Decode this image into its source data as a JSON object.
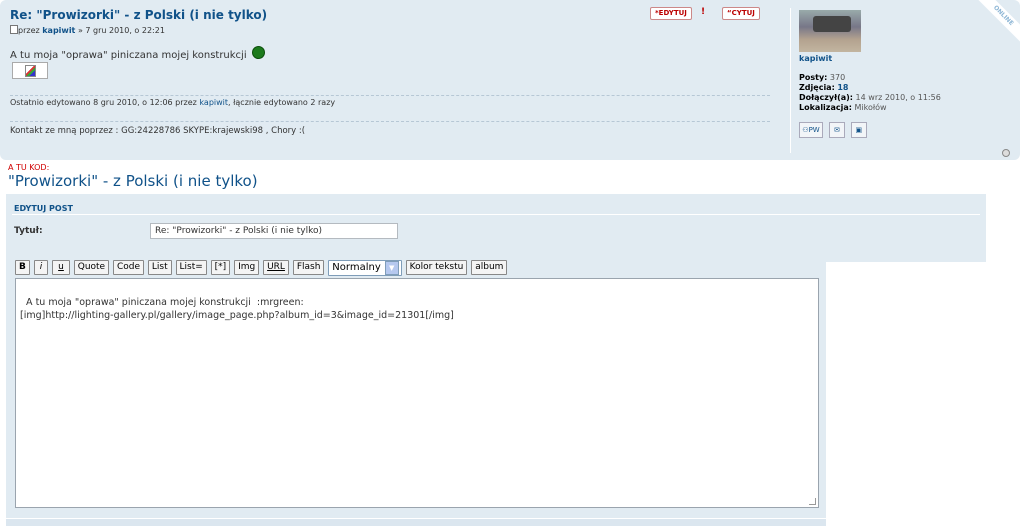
{
  "post": {
    "title": "Re: \"Prowizorki\" - z Polski (i nie tylko)",
    "meta_prefix": "przez",
    "author": "kapiwit",
    "date": "» 7 gru 2010, o 22:21",
    "body": "A tu moja \"oprawa\" piniczana mojej konstrukcji",
    "smiley_icon": "mrgreen-smiley-icon",
    "edited_prefix": "Ostatnio edytowano 8 gru 2010, o 12:06 przez",
    "edited_user": "kapiwit",
    "edited_suffix": ", łącznie edytowano 2 razy",
    "contact": "Kontakt ze mną poprzez : GG:24228786 SKYPE:krajewski98 , Chory :(",
    "edit_button": "EDYTUJ",
    "report_button": "!",
    "quote_button": "CYTUJ",
    "online_badge": "ONLINE"
  },
  "profile": {
    "name": "kapiwit",
    "posts_label": "Posty:",
    "posts_value": "370",
    "photos_label": "Zdjęcia:",
    "photos_value": "18",
    "joined_label": "Dołączył(a):",
    "joined_value": "14 wrz 2010, o 11:56",
    "location_label": "Lokalizacja:",
    "location_value": "Mikołów",
    "pm_label": "PW"
  },
  "code_label": "A TU KOD:",
  "topic_title": "\"Prowizorki\" - z Polski (i nie tylko)",
  "form": {
    "header": "EDYTUJ POST",
    "title_label": "Tytuł:",
    "title_value": "Re: \"Prowizorki\" - z Polski (i nie tylko)",
    "toolbar": [
      "B",
      "i",
      "u",
      "Quote",
      "Code",
      "List",
      "List=",
      "[*]",
      "Img",
      "URL",
      "Flash"
    ],
    "size_select": "Normalny",
    "color_button": "Kolor tekstu",
    "album_button": "album",
    "message": "A tu moja \"oprawa\" piniczana mojej konstrukcji  :mrgreen:\n[img]http://lighting-gallery.pl/gallery/image_page.php?album_id=3&image_id=21301[/img]"
  },
  "colors": {
    "panel_bg": "#e1ebf2",
    "link": "#105289",
    "accent_red": "#d00000"
  }
}
